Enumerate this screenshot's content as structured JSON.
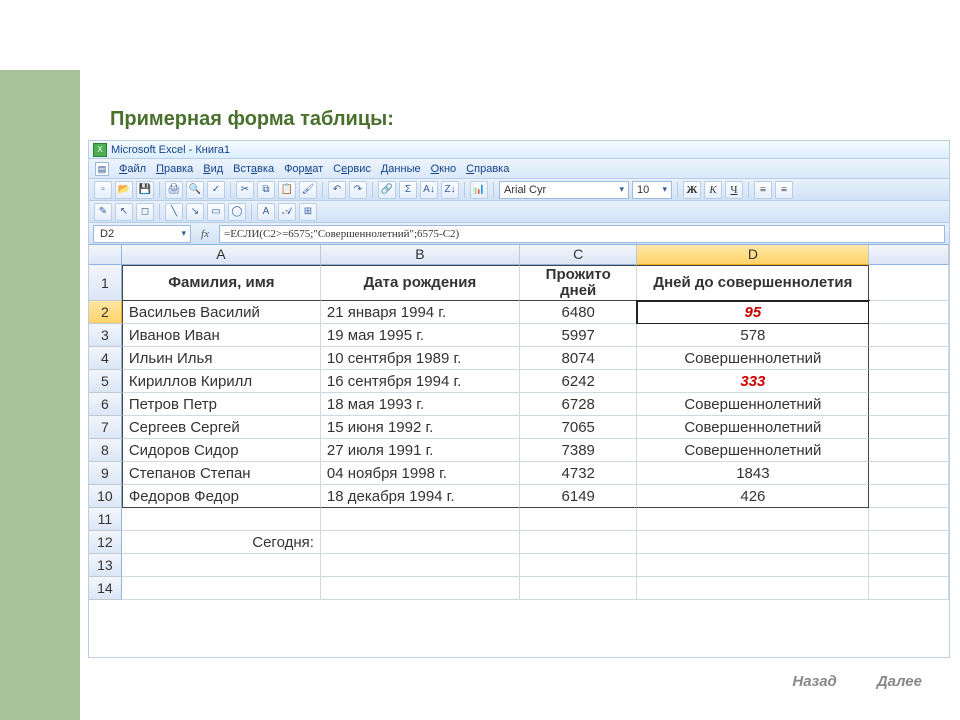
{
  "slide_title": "Примерная форма таблицы:",
  "app": {
    "title": "Microsoft Excel - Книга1",
    "icon_letter": "X"
  },
  "menu": {
    "items": [
      "Файл",
      "Правка",
      "Вид",
      "Вставка",
      "Формат",
      "Сервис",
      "Данные",
      "Окно",
      "Справка"
    ]
  },
  "font_controls": {
    "font": "Arial Cyr",
    "size": "10",
    "bold": "Ж",
    "italic": "К",
    "underline": "Ч"
  },
  "formula_bar": {
    "namebox": "D2",
    "fx": "fx",
    "formula": "=ЕСЛИ(C2>=6575;\"Совершеннолетний\";6575-C2)"
  },
  "columns": [
    "A",
    "B",
    "C",
    "D"
  ],
  "row_numbers": [
    "1",
    "2",
    "3",
    "4",
    "5",
    "6",
    "7",
    "8",
    "9",
    "10",
    "11",
    "12",
    "13",
    "14"
  ],
  "header_row": {
    "a": "Фамилия, имя",
    "b": "Дата рождения",
    "c": "Прожито дней",
    "d": "Дней до совершеннолетия"
  },
  "rows": [
    {
      "a": "Васильев Василий",
      "b": "21 января 1994 г.",
      "c": "6480",
      "d": "95",
      "d_red": true,
      "active": true
    },
    {
      "a": "Иванов Иван",
      "b": "19 мая 1995 г.",
      "c": "5997",
      "d": "578"
    },
    {
      "a": "Ильин Илья",
      "b": "10 сентября 1989 г.",
      "c": "8074",
      "d": "Совершеннолетний"
    },
    {
      "a": "Кириллов Кирилл",
      "b": "16 сентября 1994 г.",
      "c": "6242",
      "d": "333",
      "d_red": true
    },
    {
      "a": "Петров Петр",
      "b": "18 мая 1993 г.",
      "c": "6728",
      "d": "Совершеннолетний"
    },
    {
      "a": "Сергеев Сергей",
      "b": "15 июня 1992 г.",
      "c": "7065",
      "d": "Совершеннолетний"
    },
    {
      "a": "Сидоров Сидор",
      "b": "27 июля 1991 г.",
      "c": "7389",
      "d": "Совершеннолетний"
    },
    {
      "a": "Степанов Степан",
      "b": "04 ноября 1998 г.",
      "c": "4732",
      "d": "1843"
    },
    {
      "a": "Федоров Федор",
      "b": "18 декабря 1994 г.",
      "c": "6149",
      "d": "426"
    }
  ],
  "today_label": "Сегодня:",
  "nav": {
    "back": "Назад",
    "next": "Далее"
  }
}
